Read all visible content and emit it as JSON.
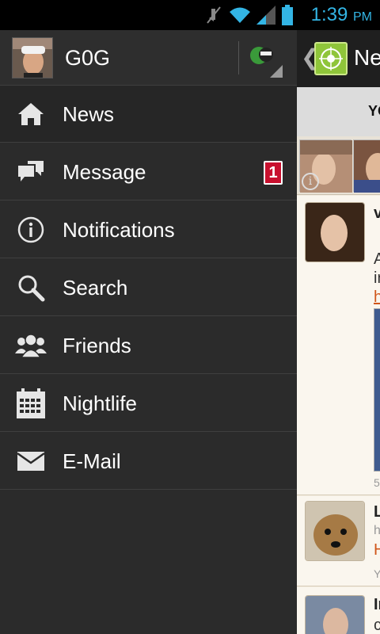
{
  "status_bar": {
    "time": "1:39",
    "ampm": "PM",
    "icons": [
      "mute-icon",
      "wifi-icon",
      "signal-icon",
      "battery-icon"
    ],
    "accent": "#33b5e5"
  },
  "drawer": {
    "username": "G0G",
    "items": [
      {
        "label": "News",
        "icon": "home-icon",
        "active": true
      },
      {
        "label": "Message",
        "icon": "chat-bubbles-icon",
        "badge": "1"
      },
      {
        "label": "Notifications",
        "icon": "info-icon"
      },
      {
        "label": "Search",
        "icon": "magnifier-icon"
      },
      {
        "label": "Friends",
        "icon": "friends-icon"
      },
      {
        "label": "Nightlife",
        "icon": "calendar-icon"
      },
      {
        "label": "E-Mail",
        "icon": "envelope-icon"
      }
    ]
  },
  "content": {
    "back_glyph": "❮",
    "title": "Ne",
    "tab": "YO",
    "feed": [
      {
        "line1": "v",
        "line2": "A",
        "line3": "ir",
        "link": "h",
        "meta": "5"
      },
      {
        "line1": "L",
        "line2": "h",
        "link": "H",
        "meta": "Y"
      },
      {
        "line1": "Ir",
        "line2": "c"
      }
    ]
  },
  "colors": {
    "drawer_bg": "#2b2b2b",
    "badge": "#c8102e",
    "content_bg": "#f3ece0",
    "link": "#d0561a"
  }
}
